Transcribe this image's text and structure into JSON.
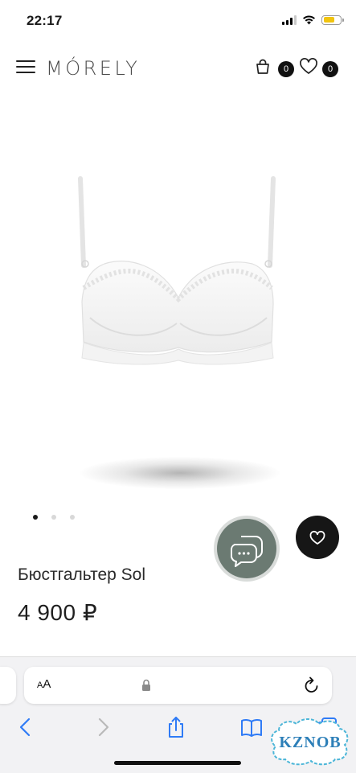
{
  "status_bar": {
    "time": "22:17"
  },
  "header": {
    "logo": "MÓRELY",
    "cart_count": "0",
    "favorites_count": "0"
  },
  "product": {
    "name": "Бюстгальтер Sol",
    "price": "4 900 ₽",
    "image_count": 3,
    "active_image_index": 0
  },
  "browser": {
    "text_size_label_small": "A",
    "text_size_label_large": "A"
  },
  "watermark": {
    "text": "KZNOB"
  },
  "colors": {
    "chat_button": "#6b7a72",
    "favorite_button": "#161616",
    "badge": "#111111",
    "battery": "#f1c40f",
    "safari_blue": "#2f7bf6"
  },
  "icons": [
    "menu-icon",
    "cart-icon",
    "heart-icon",
    "chat-icon",
    "lock-icon",
    "reload-icon",
    "back-icon",
    "forward-icon",
    "share-icon",
    "bookmarks-icon",
    "tabs-icon"
  ]
}
